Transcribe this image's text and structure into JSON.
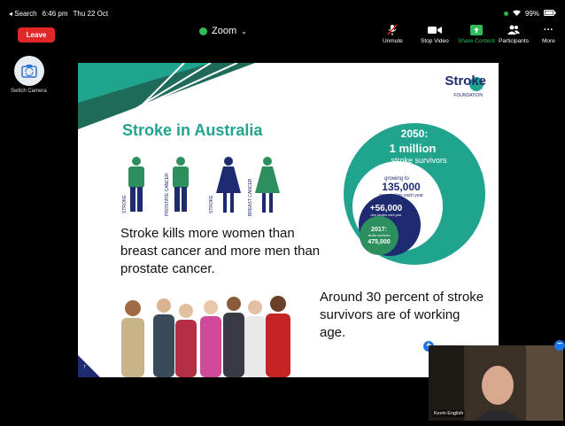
{
  "status": {
    "back": "◂ Search",
    "time": "6:46 pm",
    "date": "Thu 22 Oct",
    "battery": "99%"
  },
  "toolbar": {
    "leave": "Leave",
    "meeting_name": "Zoom",
    "items": [
      {
        "label": "Unmute",
        "icon": "microphone-muted-icon"
      },
      {
        "label": "Stop Video",
        "icon": "video-camera-icon"
      },
      {
        "label": "Share Content",
        "icon": "share-content-icon"
      },
      {
        "label": "Participants",
        "icon": "participants-icon"
      },
      {
        "label": "More",
        "icon": "more-icon"
      }
    ]
  },
  "switch_camera": {
    "label": "Switch Camera"
  },
  "slide": {
    "title": "Stroke in Australia",
    "logo": "Stroke",
    "logo_sub": "FOUNDATION",
    "figure_labels": [
      "STROKE",
      "PROSTATE CANCER",
      "STROKE",
      "BREAST CANCER"
    ],
    "stat_text": "Stroke kills more women than breast cancer and more men than prostate cancer.",
    "working_age": "Around 30 percent of stroke survivors are of working age.",
    "slide_number": "7",
    "circles": {
      "year_2050": "2050:",
      "million": "1 million",
      "survivors": "stroke survivors",
      "growing": "growing to",
      "strokes_135": "135,000",
      "new_strokes": "new strokes each year",
      "plus56": "+56,000",
      "plus56_sub": "new strokes each year",
      "year_2017": "2017:",
      "survivors_sub": "stroke survivors",
      "count_475": "475,000"
    }
  },
  "self_view": {
    "name": "Kevin English"
  },
  "colors": {
    "teal": "#21a48e",
    "navy": "#1e2b70",
    "green": "#2e8f5e",
    "leave": "#e02828"
  }
}
